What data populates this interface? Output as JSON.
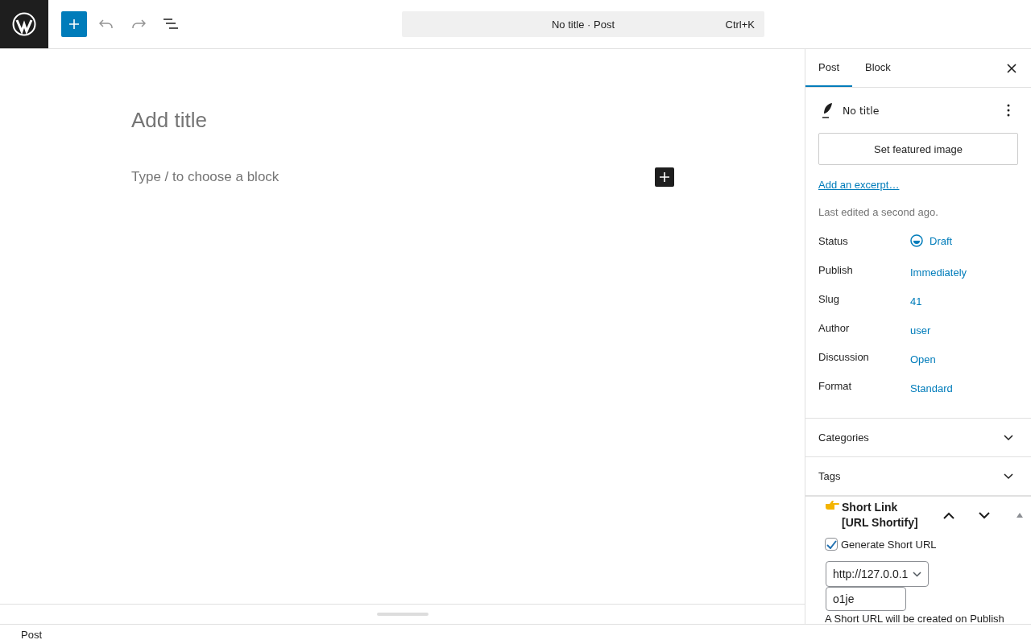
{
  "command_bar": {
    "title": "No title · Post",
    "shortcut": "Ctrl+K"
  },
  "editor": {
    "title_placeholder": "Add title",
    "block_placeholder": "Type / to choose a block"
  },
  "sidebar": {
    "tabs": [
      {
        "label": "Post",
        "selected": true
      },
      {
        "label": "Block",
        "selected": false
      }
    ],
    "post_title": "No title",
    "featured_image_button": "Set featured image",
    "excerpt_link": "Add an excerpt…",
    "last_edited": "Last edited a second ago.",
    "fields": [
      {
        "label": "Status",
        "value": "Draft",
        "kind": "status"
      },
      {
        "label": "Publish",
        "value": "Immediately",
        "kind": "link"
      },
      {
        "label": "Slug",
        "value": "41",
        "kind": "link"
      },
      {
        "label": "Author",
        "value": "user",
        "kind": "link"
      },
      {
        "label": "Discussion",
        "value": "Open",
        "kind": "link"
      },
      {
        "label": "Format",
        "value": "Standard",
        "kind": "link"
      }
    ],
    "panels": [
      {
        "title": "Categories",
        "expanded": false
      },
      {
        "title": "Tags",
        "expanded": false
      }
    ],
    "short_link": {
      "title_line_1": "Short Link",
      "title_line_2": "[URL Shortify]",
      "expanded": true,
      "checkbox_label": "Generate Short URL",
      "checked": true,
      "domain": "http://127.0.0.1",
      "slug": "o1je",
      "note": "A Short URL will be created on Publish"
    }
  },
  "footer": {
    "breadcrumb": "Post"
  }
}
